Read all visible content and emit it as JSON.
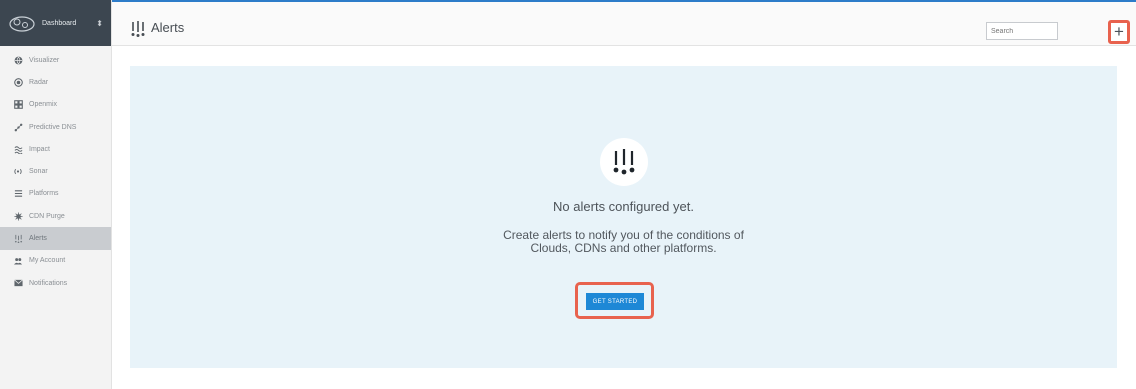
{
  "sidebar": {
    "title": "Dashboard",
    "pin_glyph": "⬍",
    "items": [
      {
        "label": "Visualizer",
        "icon": "globe-icon"
      },
      {
        "label": "Radar",
        "icon": "radar-icon"
      },
      {
        "label": "Openmix",
        "icon": "openmix-icon"
      },
      {
        "label": "Predictive DNS",
        "icon": "predictive-dns-icon"
      },
      {
        "label": "Impact",
        "icon": "impact-icon"
      },
      {
        "label": "Sonar",
        "icon": "sonar-icon"
      },
      {
        "label": "Platforms",
        "icon": "platforms-icon"
      },
      {
        "label": "CDN Purge",
        "icon": "cdn-purge-icon"
      },
      {
        "label": "Alerts",
        "icon": "alerts-icon",
        "active": true
      },
      {
        "label": "My Account",
        "icon": "account-icon"
      },
      {
        "label": "Notifications",
        "icon": "envelope-icon"
      }
    ]
  },
  "header": {
    "title": "Alerts",
    "search_placeholder": "Search",
    "add_label": "+"
  },
  "main": {
    "empty_title": "No alerts configured yet.",
    "empty_description": "Create alerts to notify you of the conditions of Clouds, CDNs and other platforms.",
    "cta_label": "GET STARTED"
  },
  "colors": {
    "sidebar_header": "#3c4650",
    "panel_bg": "#e8f3f9",
    "cta": "#1e88d6",
    "highlight": "#e8624e"
  }
}
